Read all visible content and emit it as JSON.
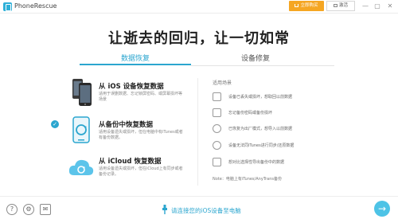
{
  "app": {
    "title": "PhoneRescue"
  },
  "titlebar": {
    "buy_label": "立即购买",
    "register_label": "激活",
    "minimize": "—",
    "maximize": "▢",
    "close": "✕"
  },
  "main": {
    "title": "让逝去的回归，让一切如常"
  },
  "tabs": [
    {
      "label": "数据恢复",
      "active": true
    },
    {
      "label": "设备修复",
      "active": false
    }
  ],
  "options": [
    {
      "title": "从 iOS 设备恢复数据",
      "desc": "适用于误删数据、忘记锁屏密码、或屏幕损坏等场景",
      "icon": "iphone-devices-icon",
      "selected": false
    },
    {
      "title": "从备份中恢复数据",
      "desc": "适用设备遗失或损坏，但在电脑中有iTunes或者有备份数据。",
      "icon": "backup-restore-icon",
      "selected": true
    },
    {
      "title": "从 iCloud 恢复数据",
      "desc": "适用设备遗失或损坏，但在iCloud上有同步或者备份记录。",
      "icon": "icloud-icon",
      "selected": false
    }
  ],
  "scenarios": {
    "heading": "适用场景",
    "items": [
      {
        "text": "设备已丢失或损坏，想取回以前数据",
        "icon": "lost-phone-icon"
      },
      {
        "text": "忘记备份密码或备份损坏",
        "icon": "lock-icon"
      },
      {
        "text": "已恢复为出厂模式，想导入以前数据",
        "icon": "reset-icon"
      },
      {
        "text": "设备无法同iTunes进行同步/还原数据",
        "icon": "sync-icon"
      },
      {
        "text": "想对比选择性导出备份中的数据",
        "icon": "document-icon"
      }
    ],
    "note": "Note：电脑上有iTunes/AnyTrans备份"
  },
  "bottom": {
    "connect_text": "请连接您的iOS设备至电脑",
    "next_arrow": "→"
  },
  "colors": {
    "accent": "#2ba6cf",
    "buy": "#f5a623",
    "next": "#4dc3e6"
  }
}
